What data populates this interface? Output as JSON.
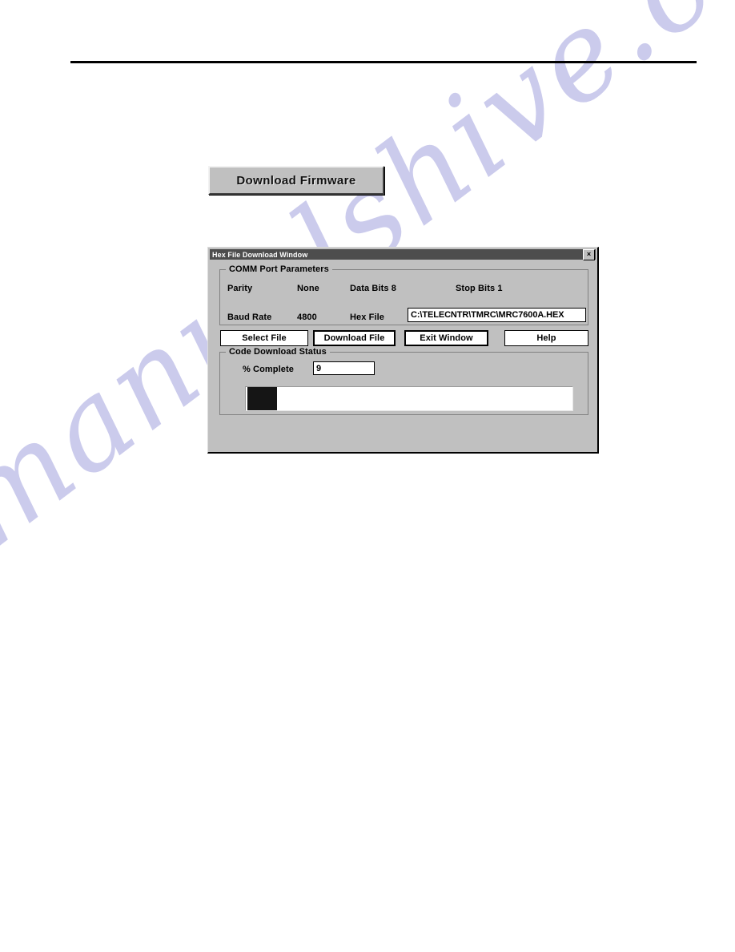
{
  "page": {
    "watermark": "manualshive.com"
  },
  "firmware_button": {
    "label": "Download Firmware"
  },
  "dialog": {
    "title": "Hex File Download Window",
    "close_label": "×",
    "comm_group": {
      "title": "COMM Port Parameters",
      "parity_label": "Parity",
      "parity_value": "None",
      "data_bits_label": "Data Bits 8",
      "stop_bits_label": "Stop Bits 1",
      "baud_rate_label": "Baud Rate",
      "baud_rate_value": "4800",
      "hex_file_label": "Hex File",
      "hex_file_path": "C:\\TELECNTR\\TMRC\\MRC7600A.HEX"
    },
    "buttons": {
      "select_file": "Select File",
      "download_file": "Download File",
      "exit_window": "Exit Window",
      "help": "Help"
    },
    "status_group": {
      "title": "Code Download Status",
      "percent_label": "% Complete",
      "percent_value": "9",
      "progress_percent": 9
    }
  },
  "colors": {
    "dialog_face": "#c0c0c0",
    "titlebar": "#4d4d4d",
    "progress_fill": "#151515",
    "watermark": "#c9c9ec"
  }
}
